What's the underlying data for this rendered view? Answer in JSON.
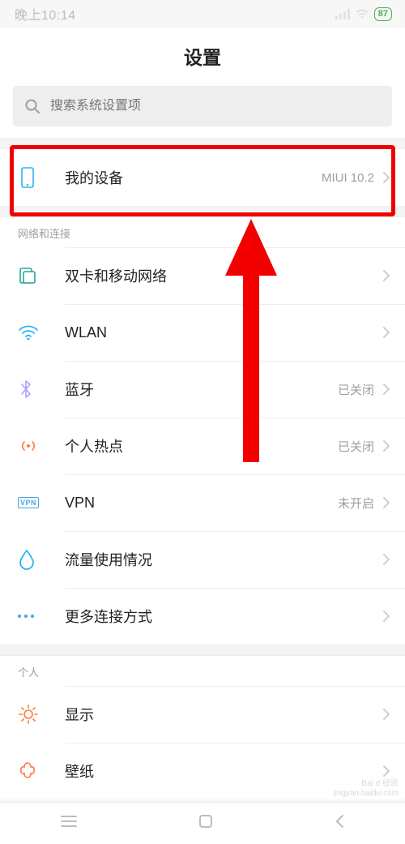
{
  "status": {
    "time": "晚上10:14",
    "battery": "87"
  },
  "title": "设置",
  "search": {
    "placeholder": "搜索系统设置项"
  },
  "device": {
    "label": "我的设备",
    "value": "MIUI 10.2"
  },
  "section_network": {
    "header": "网络和连接",
    "sim": {
      "label": "双卡和移动网络"
    },
    "wlan": {
      "label": "WLAN"
    },
    "bluetooth": {
      "label": "蓝牙",
      "value": "已关闭"
    },
    "hotspot": {
      "label": "个人热点",
      "value": "已关闭"
    },
    "vpn": {
      "label": "VPN",
      "value": "未开启",
      "chip": "VPN"
    },
    "data": {
      "label": "流量使用情况"
    },
    "more": {
      "label": "更多连接方式"
    }
  },
  "section_personal": {
    "header": "个人",
    "display": {
      "label": "显示"
    },
    "wallpaper": {
      "label": "壁纸"
    }
  },
  "watermark": {
    "l1": "Bai d 经验",
    "l2": "jingyan.baidu.com"
  }
}
